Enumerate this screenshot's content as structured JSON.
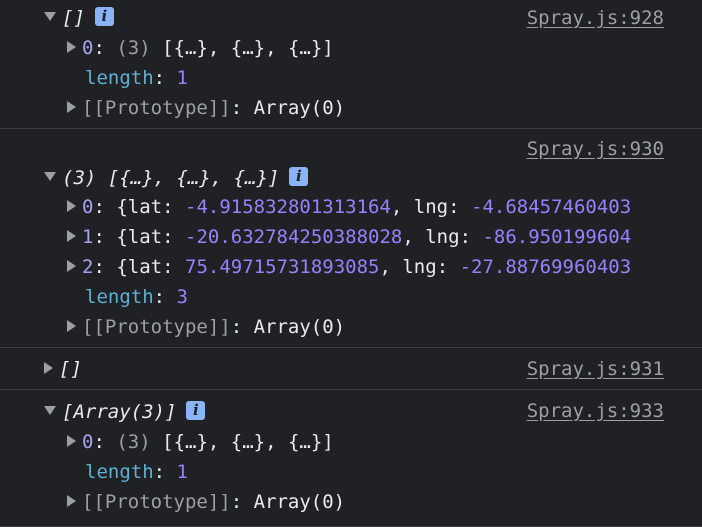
{
  "entries": [
    {
      "header": "[]",
      "source": "Spray.js:928",
      "rows": [
        {
          "key": "0",
          "count": "(3)",
          "value": "[{…}, {…}, {…}]"
        },
        {
          "key": "length",
          "value": "1"
        },
        {
          "key": "[[Prototype]]",
          "value": "Array(0)"
        }
      ]
    },
    {
      "header": "(3) [{…}, {…}, {…}]",
      "source": "Spray.js:930",
      "rows": [
        {
          "key": "0",
          "lat_label": "lat",
          "lat": "-4.915832801313164",
          "lng_label": "lng",
          "lng": "-4.68457460403"
        },
        {
          "key": "1",
          "lat_label": "lat",
          "lat": "-20.632784250388028",
          "lng_label": "lng",
          "lng": "-86.950199604"
        },
        {
          "key": "2",
          "lat_label": "lat",
          "lat": "75.49715731893085",
          "lng_label": "lng",
          "lng": "-27.88769960403"
        },
        {
          "key": "length",
          "value": "3"
        },
        {
          "key": "[[Prototype]]",
          "value": "Array(0)"
        }
      ]
    },
    {
      "header": "[]",
      "source": "Spray.js:931"
    },
    {
      "header": "[Array(3)]",
      "source": "Spray.js:933",
      "rows": [
        {
          "key": "0",
          "count": "(3)",
          "value": "[{…}, {…}, {…}]"
        },
        {
          "key": "length",
          "value": "1"
        },
        {
          "key": "[[Prototype]]",
          "value": "Array(0)"
        }
      ]
    }
  ],
  "info_icon_glyph": "i",
  "colors": {
    "background": "#202124",
    "text": "#e8eaed",
    "key": "#a7a3f0",
    "number": "#9980ff",
    "length_key": "#5db0d7",
    "muted": "#9aa0a6",
    "info_badge": "#8ab4f8"
  }
}
